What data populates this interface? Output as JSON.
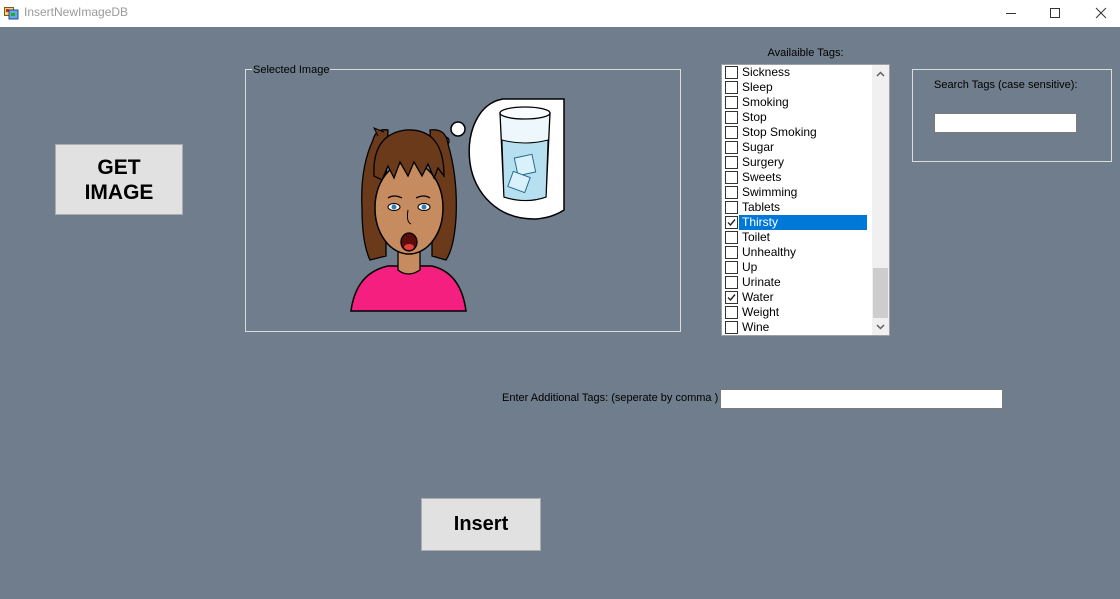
{
  "window": {
    "title": "InsertNewImageDB"
  },
  "buttons": {
    "get_image": "GET\nIMAGE",
    "insert": "Insert"
  },
  "image_group": {
    "label": "Selected Image"
  },
  "tags": {
    "title": "Availaible Tags:",
    "items": [
      {
        "label": "Sickness",
        "checked": false,
        "selected": false
      },
      {
        "label": "Sleep",
        "checked": false,
        "selected": false
      },
      {
        "label": "Smoking",
        "checked": false,
        "selected": false
      },
      {
        "label": "Stop",
        "checked": false,
        "selected": false
      },
      {
        "label": "Stop Smoking",
        "checked": false,
        "selected": false
      },
      {
        "label": "Sugar",
        "checked": false,
        "selected": false
      },
      {
        "label": "Surgery",
        "checked": false,
        "selected": false
      },
      {
        "label": "Sweets",
        "checked": false,
        "selected": false
      },
      {
        "label": "Swimming",
        "checked": false,
        "selected": false
      },
      {
        "label": "Tablets",
        "checked": false,
        "selected": false
      },
      {
        "label": "Thirsty",
        "checked": true,
        "selected": true
      },
      {
        "label": "Toilet",
        "checked": false,
        "selected": false
      },
      {
        "label": "Unhealthy",
        "checked": false,
        "selected": false
      },
      {
        "label": "Up",
        "checked": false,
        "selected": false
      },
      {
        "label": "Urinate",
        "checked": false,
        "selected": false
      },
      {
        "label": "Water",
        "checked": true,
        "selected": false
      },
      {
        "label": "Weight",
        "checked": false,
        "selected": false
      },
      {
        "label": "Wine",
        "checked": false,
        "selected": false
      }
    ]
  },
  "search": {
    "label": "Search Tags (case sensitive):",
    "value": ""
  },
  "additional_tags": {
    "label": "Enter Additional Tags: (seperate by comma )",
    "value": ""
  },
  "colors": {
    "background": "#6f7d8c",
    "selection": "#0078d7",
    "button_face": "#e1e1e1"
  },
  "icons": {
    "app": "app-icon",
    "minimize": "minimize-icon",
    "maximize": "maximize-icon",
    "close": "close-icon",
    "scroll_up": "chevron-up-icon",
    "scroll_down": "chevron-down-icon",
    "checkmark": "checkmark-icon"
  }
}
